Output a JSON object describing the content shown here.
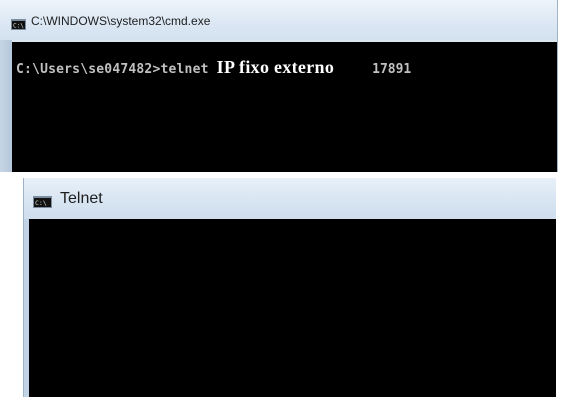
{
  "cmd_window": {
    "title": "C:\\WINDOWS\\system32\\cmd.exe",
    "icon": "cmd-icon",
    "console": {
      "prompt": "C:\\Users\\se047482>telnet",
      "ip_text": "IP fixo externo",
      "port": "17891"
    }
  },
  "telnet_window": {
    "title": "Telnet",
    "icon": "cmd-icon"
  }
}
